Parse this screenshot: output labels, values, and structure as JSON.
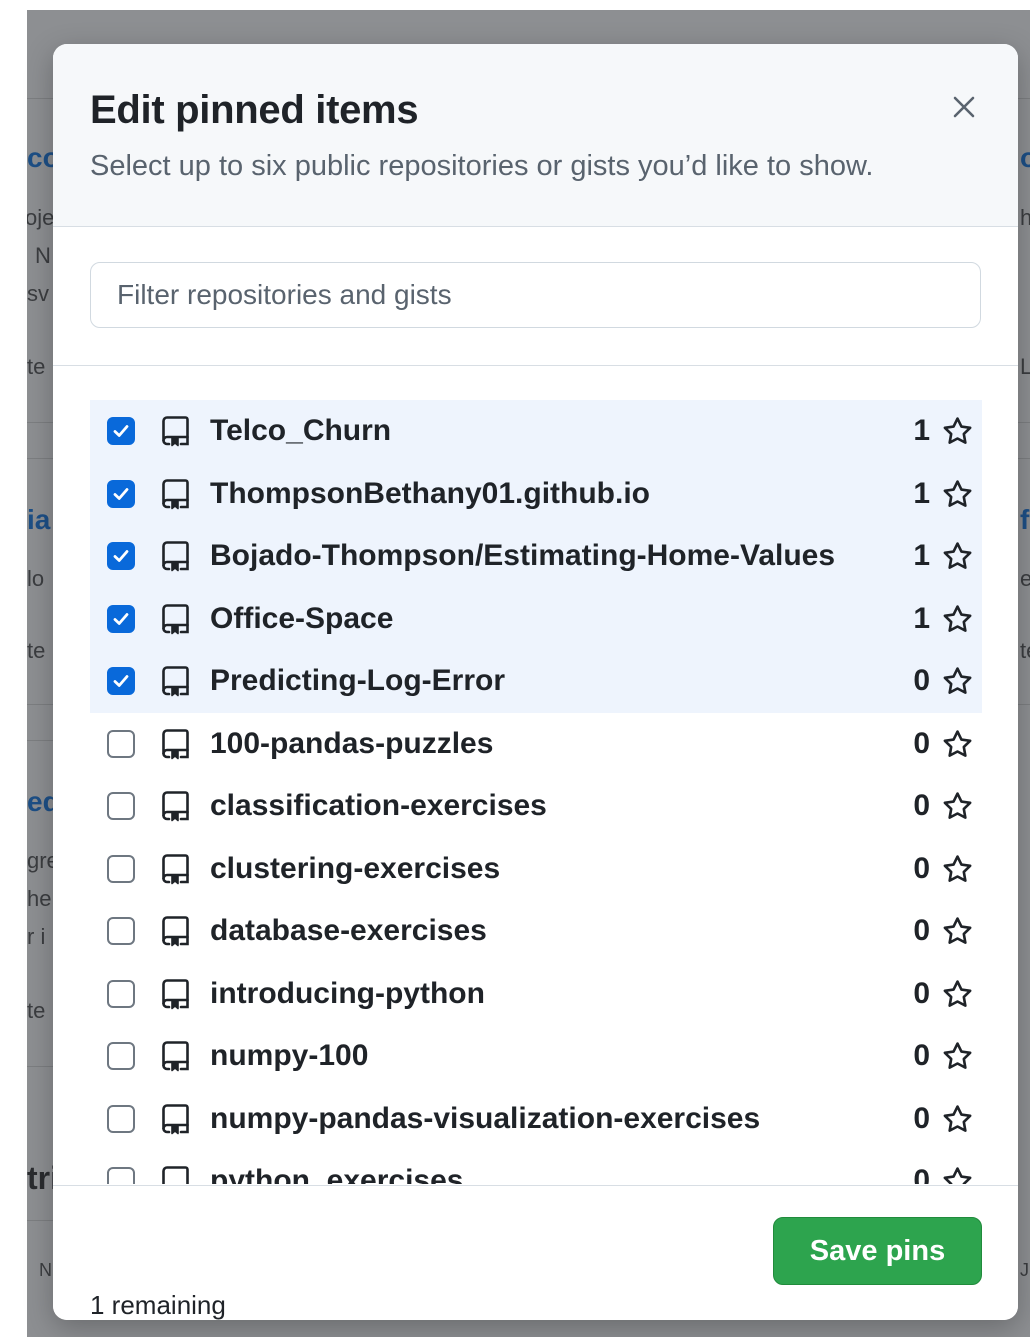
{
  "modal": {
    "title": "Edit pinned items",
    "subtitle": "Select up to six public repositories or gists you’d like to show."
  },
  "filter": {
    "placeholder": "Filter repositories and gists",
    "value": ""
  },
  "repositories": [
    {
      "name": "Telco_Churn",
      "stars": "1",
      "checked": true
    },
    {
      "name": "ThompsonBethany01.github.io",
      "stars": "1",
      "checked": true
    },
    {
      "name": "Bojado-Thompson/Estimating-Home-Values",
      "stars": "1",
      "checked": true
    },
    {
      "name": "Office-Space",
      "stars": "1",
      "checked": true
    },
    {
      "name": "Predicting-Log-Error",
      "stars": "0",
      "checked": true
    },
    {
      "name": "100-pandas-puzzles",
      "stars": "0",
      "checked": false
    },
    {
      "name": "classification-exercises",
      "stars": "0",
      "checked": false
    },
    {
      "name": "clustering-exercises",
      "stars": "0",
      "checked": false
    },
    {
      "name": "database-exercises",
      "stars": "0",
      "checked": false
    },
    {
      "name": "introducing-python",
      "stars": "0",
      "checked": false
    },
    {
      "name": "numpy-100",
      "stars": "0",
      "checked": false
    },
    {
      "name": "numpy-pandas-visualization-exercises",
      "stars": "0",
      "checked": false
    },
    {
      "name": "python_exercises",
      "stars": "0",
      "checked": false
    }
  ],
  "footer": {
    "remaining": "1 remaining",
    "save_label": "Save pins"
  },
  "background": {
    "fragments": [
      "co",
      "oje",
      "N",
      "sv",
      "te",
      "ia",
      "lo",
      "te",
      "ed",
      "gre",
      "he",
      "r i",
      "te",
      "tri",
      "N",
      "o",
      "h",
      "L",
      "fi",
      "e",
      "te",
      "J"
    ]
  },
  "colors": {
    "accent_blue": "#0969da",
    "selected_row": "#eef4fd",
    "save_green": "#2da44e",
    "backdrop": "#8d8f92"
  },
  "icons": {
    "close": "close-icon",
    "repo": "repo-icon",
    "star": "star-icon",
    "check": "check-icon"
  }
}
